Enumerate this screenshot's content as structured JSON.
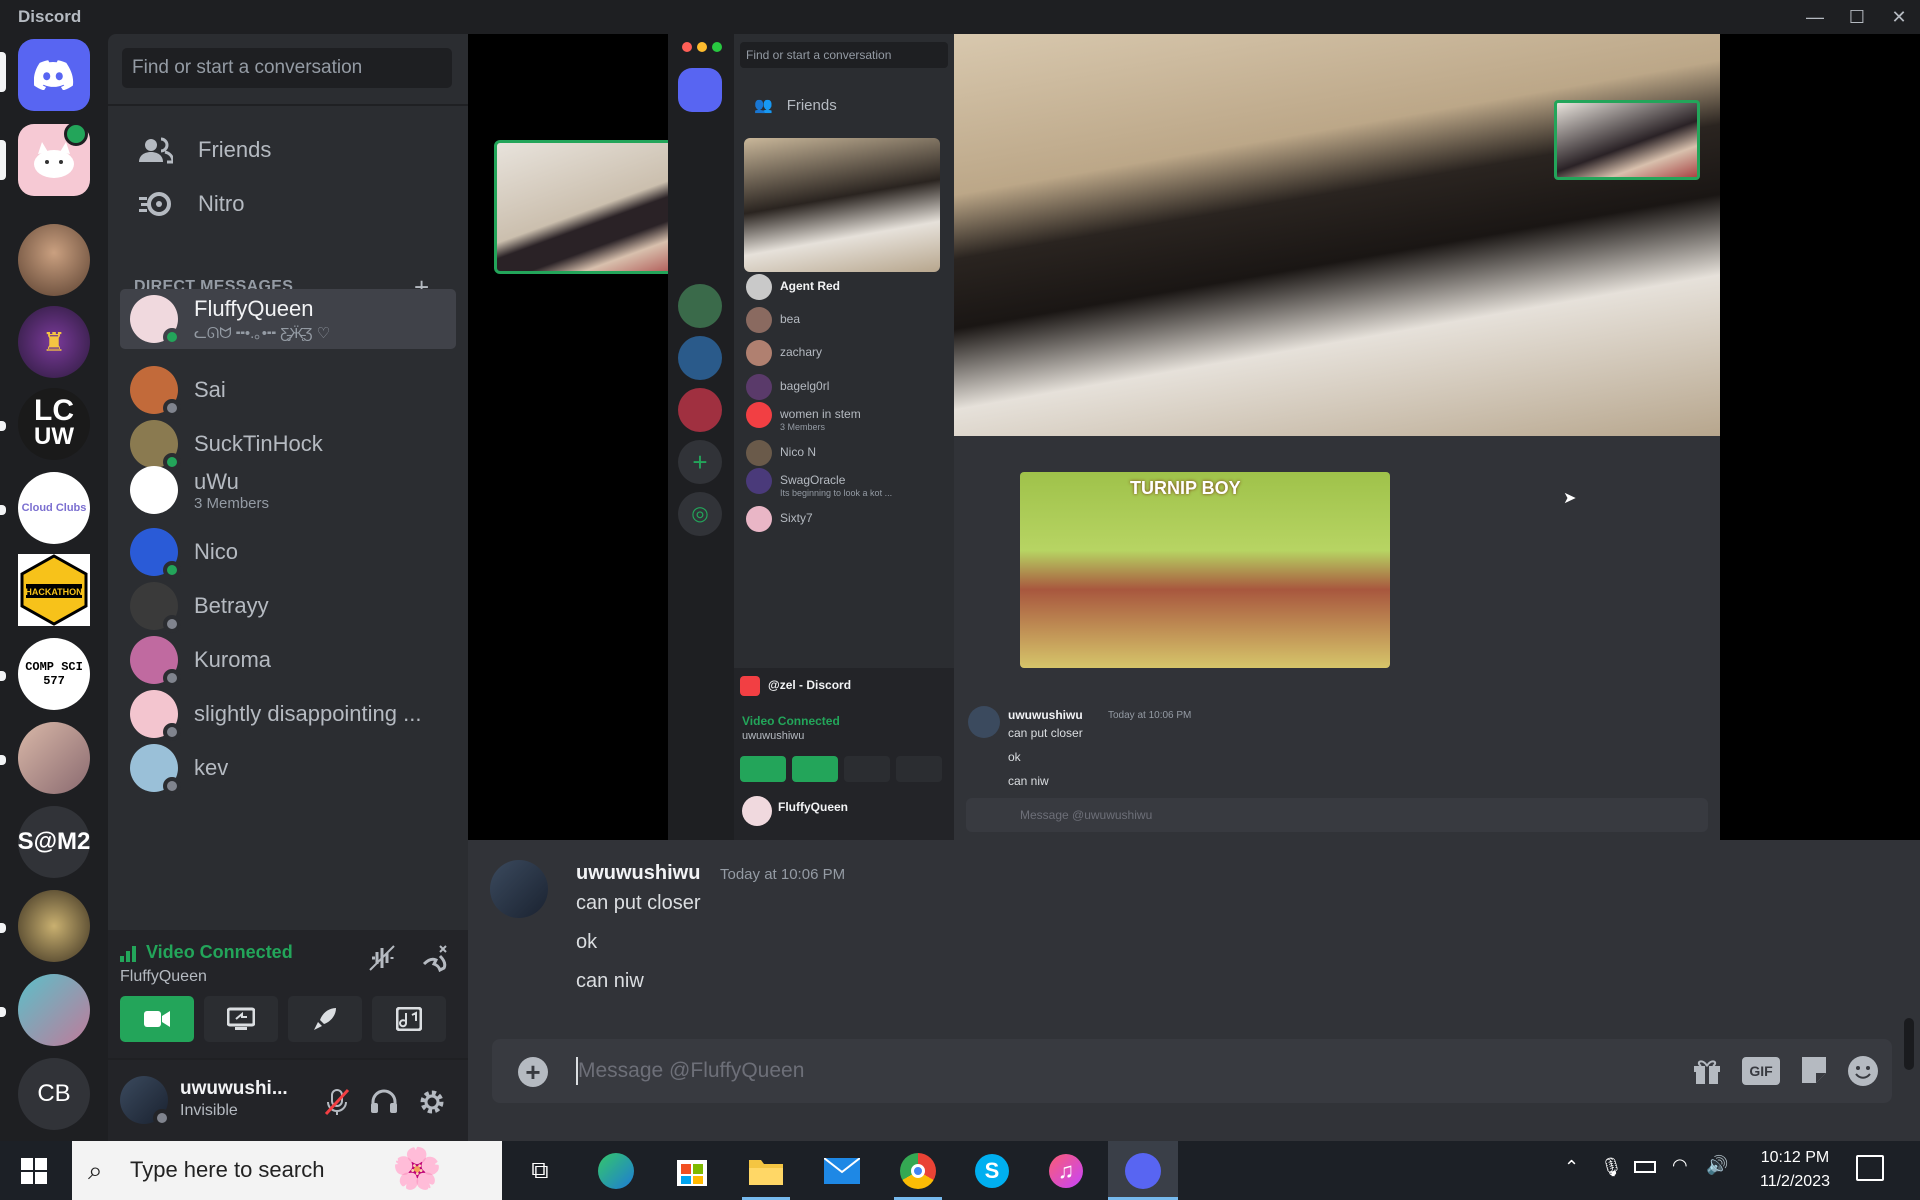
{
  "window": {
    "title": "Discord",
    "controls": [
      "—",
      "☐",
      "✕"
    ]
  },
  "guilds": [
    {
      "name": "home",
      "label": ""
    },
    {
      "name": "cat-server",
      "label": ""
    },
    {
      "name": "user-avatar-1",
      "label": ""
    },
    {
      "name": "server-icon-3",
      "label": ""
    },
    {
      "name": "lcuw-server",
      "label": "LC\nUW"
    },
    {
      "name": "cloud-clubs",
      "label": "Cloud Clubs"
    },
    {
      "name": "uiowa-hackathon",
      "label": "UIOWA HACKATHON"
    },
    {
      "name": "comp-sci-577",
      "label": "COMP SCI 577"
    },
    {
      "name": "anime-server",
      "label": ""
    },
    {
      "name": "sam2-server",
      "label": "S@M2"
    },
    {
      "name": "emblem-server",
      "label": ""
    },
    {
      "name": "miku-server",
      "label": ""
    },
    {
      "name": "cb-server",
      "label": "CB"
    }
  ],
  "dm_panel": {
    "search_placeholder": "Find or start a conversation",
    "nav": {
      "friends": "Friends",
      "nitro": "Nitro"
    },
    "header": "DIRECT MESSAGES",
    "items": [
      {
        "name": "FluffyQueen",
        "sub": "ᓚᘏᗢ ╍•.｡•╍ Ƹ̵̡Ӝ̵̨̄Ʒ ♡",
        "status": "online",
        "active": true,
        "color": "#f0d9de"
      },
      {
        "name": "Sai",
        "sub": "",
        "status": "offline",
        "color": "#c26a3a"
      },
      {
        "name": "SuckTinHock",
        "sub": "",
        "status": "online",
        "color": "#8a7a50"
      },
      {
        "name": "uWu",
        "sub": "3 Members",
        "status": "",
        "color": "#ffffff"
      },
      {
        "name": "Nico",
        "sub": "",
        "status": "mobile",
        "color": "#2a5bd7"
      },
      {
        "name": "Betrayy",
        "sub": "",
        "status": "offline",
        "color": "#3a3a3a"
      },
      {
        "name": "Kuroma",
        "sub": "",
        "status": "offline",
        "color": "#c06aa0"
      },
      {
        "name": "slightly disappointing ...",
        "sub": "",
        "status": "offline",
        "color": "#f3c5cf"
      },
      {
        "name": "kev",
        "sub": "",
        "status": "offline",
        "color": "#9ac0d8"
      }
    ]
  },
  "voice": {
    "status": "Video Connected",
    "channel": "FluffyQueen"
  },
  "user": {
    "name": "uwuwushi...",
    "status": "Invisible"
  },
  "message": {
    "author": "uwuwushiwu",
    "time": "Today at 10:06 PM",
    "lines": [
      "can put closer",
      "ok",
      "can niw"
    ],
    "input_placeholder": "Message @FluffyQueen"
  },
  "screenshare": {
    "search_placeholder": "Find or start a conversation",
    "friends": "Friends",
    "dm_list": [
      "zel",
      "Agent Red",
      "bea",
      "zachary",
      "bagelg0rl",
      "women in stem",
      "Nico N",
      "SwagOracle",
      "Sixty7"
    ],
    "women_sub": "3 Members",
    "swag_sub": "Its beginning to look a kot ...",
    "call_label": "@zel - Discord",
    "voice_status": "Video Connected",
    "voice_user": "uwuwushiwu",
    "user_name": "FluffyQueen",
    "msg_author": "uwuwushiwu",
    "msg_time": "Today at 10:06 PM",
    "msg_lines": [
      "can put closer",
      "ok",
      "can niw"
    ],
    "input_placeholder": "Message @uwuwushiwu",
    "game_title": "TURNIP BOY"
  },
  "taskbar": {
    "search_placeholder": "Type here to search",
    "time": "10:12 PM",
    "date": "11/2/2023"
  },
  "colors": {
    "accent": "#5865f2",
    "green": "#23a55a",
    "bg_main": "#313338",
    "bg_side": "#2b2d31",
    "bg_guild": "#1e1f22"
  }
}
